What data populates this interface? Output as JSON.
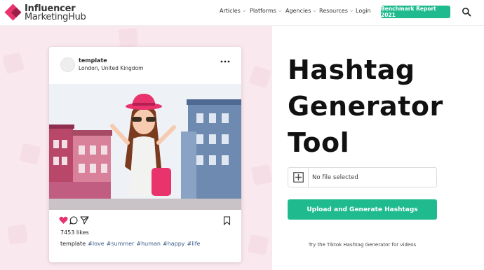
{
  "header": {
    "logo_line1": "Influencer",
    "logo_line2": "MarketingHub",
    "nav": [
      {
        "label": "Articles",
        "has_chevron": true
      },
      {
        "label": "Platforms",
        "has_chevron": true
      },
      {
        "label": "Agencies",
        "has_chevron": true
      },
      {
        "label": "Resources",
        "has_chevron": true
      },
      {
        "label": "Login",
        "has_chevron": false
      }
    ],
    "cta_label": "Benchmark Report 2021",
    "search_icon": "search-icon"
  },
  "post": {
    "username": "template",
    "location": "London, United Kingdom",
    "likes": "7453 likes",
    "caption_user": "template",
    "hashtags": [
      "#love",
      "#summer",
      "#human",
      "#happy",
      "#life"
    ]
  },
  "hero": {
    "title_line1": "Hashtag",
    "title_line2": "Generator",
    "title_line3": "Tool",
    "file_status": "No file selected",
    "upload_label": "Upload and Generate Hashtags",
    "tiktok_note": "Try the Tiktok Hashtag Generator for videos"
  },
  "colors": {
    "brand_pink": "#e8336d",
    "accent_green": "#1fbb8f",
    "panel_pink": "#f9e8ee",
    "hashtag_blue": "#3a5f8a"
  }
}
